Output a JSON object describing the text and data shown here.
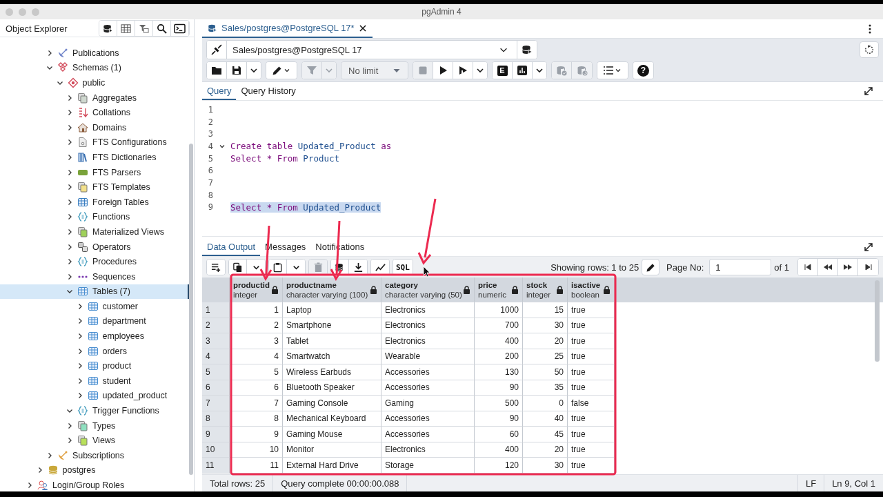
{
  "window": {
    "title": "pgAdmin 4"
  },
  "object_explorer": {
    "title": "Object Explorer",
    "tree": [
      {
        "children": [
          {
            "children": [
              {
                "label": "Publications",
                "kind": "publication",
                "expanded": false,
                "selected": false
              },
              {
                "label": "Schemas (1)",
                "kind": "schema",
                "expanded": true,
                "selected": false,
                "children": [
                  {
                    "label": "public",
                    "kind": "namespace",
                    "expanded": true,
                    "selected": false,
                    "children": [
                      {
                        "label": "Aggregates",
                        "kind": "aggregate",
                        "expanded": false,
                        "selected": false
                      },
                      {
                        "label": "Collations",
                        "kind": "collation",
                        "expanded": false,
                        "selected": false
                      },
                      {
                        "label": "Domains",
                        "kind": "domain",
                        "expanded": false,
                        "selected": false
                      },
                      {
                        "label": "FTS Configurations",
                        "kind": "fts_config",
                        "expanded": false,
                        "selected": false
                      },
                      {
                        "label": "FTS Dictionaries",
                        "kind": "fts_dict",
                        "expanded": false,
                        "selected": false
                      },
                      {
                        "label": "FTS Parsers",
                        "kind": "fts_parser",
                        "expanded": false,
                        "selected": false
                      },
                      {
                        "label": "FTS Templates",
                        "kind": "fts_template",
                        "expanded": false,
                        "selected": false
                      },
                      {
                        "label": "Foreign Tables",
                        "kind": "foreign_table",
                        "expanded": false,
                        "selected": false
                      },
                      {
                        "label": "Functions",
                        "kind": "function",
                        "expanded": false,
                        "selected": false
                      },
                      {
                        "label": "Materialized Views",
                        "kind": "matview",
                        "expanded": false,
                        "selected": false
                      },
                      {
                        "label": "Operators",
                        "kind": "operator",
                        "expanded": false,
                        "selected": false
                      },
                      {
                        "label": "Procedures",
                        "kind": "procedure",
                        "expanded": false,
                        "selected": false
                      },
                      {
                        "label": "Sequences",
                        "kind": "sequence",
                        "expanded": false,
                        "selected": false
                      },
                      {
                        "label": "Tables (7)",
                        "kind": "tables",
                        "expanded": true,
                        "selected": true,
                        "children": [
                          {
                            "label": "customer",
                            "kind": "table",
                            "expanded": false,
                            "selected": false
                          },
                          {
                            "label": "department",
                            "kind": "table",
                            "expanded": false,
                            "selected": false
                          },
                          {
                            "label": "employees",
                            "kind": "table",
                            "expanded": false,
                            "selected": false
                          },
                          {
                            "label": "orders",
                            "kind": "table",
                            "expanded": false,
                            "selected": false
                          },
                          {
                            "label": "product",
                            "kind": "table",
                            "expanded": false,
                            "selected": false
                          },
                          {
                            "label": "student",
                            "kind": "table",
                            "expanded": false,
                            "selected": false
                          },
                          {
                            "label": "updated_product",
                            "kind": "table",
                            "expanded": false,
                            "selected": false
                          }
                        ]
                      },
                      {
                        "label": "Trigger Functions",
                        "kind": "trigger_function",
                        "expanded": true,
                        "selected": false
                      },
                      {
                        "label": "Types",
                        "kind": "type",
                        "expanded": false,
                        "selected": false
                      },
                      {
                        "label": "Views",
                        "kind": "view",
                        "expanded": false,
                        "selected": false
                      }
                    ]
                  }
                ]
              },
              {
                "label": "Subscriptions",
                "kind": "subscription",
                "expanded": false,
                "selected": false
              }
            ]
          },
          {
            "label": "postgres",
            "kind": "database",
            "expanded": false,
            "selected": false
          }
        ]
      },
      {
        "label": "Login/Group Roles",
        "kind": "roles",
        "expanded": false,
        "selected": false
      }
    ]
  },
  "query_tab": {
    "label": "Sales/postgres@PostgreSQL 17*",
    "selected": true
  },
  "connection": {
    "value": "Sales/postgres@PostgreSQL 17"
  },
  "toolbar": [
    {
      "buttons": [
        {
          "kind": "open",
          "disabled": false
        },
        {
          "kind": "save",
          "disabled": false
        },
        {
          "kind": "caret",
          "disabled": false
        }
      ]
    },
    {
      "buttons": [
        {
          "kind": "edit",
          "disabled": false
        }
      ]
    },
    {
      "buttons": [
        {
          "kind": "filter",
          "disabled": true
        },
        {
          "kind": "caret",
          "disabled": true
        }
      ]
    },
    {
      "buttons": [
        {
          "kind": "limit",
          "label": "No limit",
          "disabled": true
        }
      ]
    },
    {
      "buttons": [
        {
          "kind": "stop",
          "disabled": true
        },
        {
          "kind": "run",
          "disabled": false
        },
        {
          "kind": "run_script",
          "disabled": false
        },
        {
          "kind": "caret",
          "disabled": false
        }
      ]
    },
    {
      "buttons": [
        {
          "kind": "explain",
          "label": "E",
          "disabled": false
        },
        {
          "kind": "analyze",
          "disabled": false
        },
        {
          "kind": "caret",
          "disabled": false
        }
      ]
    },
    {
      "buttons": [
        {
          "kind": "commit",
          "disabled": true
        },
        {
          "kind": "rollback",
          "disabled": true
        }
      ]
    },
    {
      "buttons": [
        {
          "kind": "macros",
          "disabled": false
        }
      ]
    },
    {
      "buttons": [
        {
          "kind": "help",
          "label": "?",
          "disabled": false
        }
      ]
    }
  ],
  "editor_tabs": [
    {
      "label": "Query",
      "selected": true
    },
    {
      "label": "Query History",
      "selected": false
    }
  ],
  "code_lines": [
    {
      "number": "1"
    },
    {
      "number": "2"
    },
    {
      "number": "3"
    },
    {
      "number": "4",
      "selected": false,
      "expanded": true,
      "tokens": [
        {
          "text": "Create table ",
          "kind": "keyword"
        },
        {
          "text": "Updated_Product ",
          "kind": "name"
        },
        {
          "text": "as",
          "kind": "keyword"
        }
      ]
    },
    {
      "number": "5",
      "selected": false,
      "tokens": [
        {
          "text": "Select * From ",
          "kind": "keyword"
        },
        {
          "text": "Product",
          "kind": "name"
        }
      ]
    },
    {
      "number": "6"
    },
    {
      "number": "7"
    },
    {
      "number": "8"
    },
    {
      "number": "9",
      "selected": true,
      "tokens": [
        {
          "text": "Select * From ",
          "kind": "keyword"
        },
        {
          "text": "Updated_Product",
          "kind": "name"
        }
      ]
    }
  ],
  "output_tabs": [
    {
      "label": "Data Output",
      "selected": true
    },
    {
      "label": "Messages",
      "selected": false
    },
    {
      "label": "Notifications",
      "selected": false
    }
  ],
  "grid_toolbar": [
    {
      "buttons": [
        {
          "kind": "add_row",
          "disabled": false
        }
      ]
    },
    {
      "buttons": [
        {
          "kind": "copy",
          "disabled": false
        },
        {
          "kind": "caret",
          "disabled": false
        }
      ]
    },
    {
      "buttons": [
        {
          "kind": "paste",
          "disabled": false
        },
        {
          "kind": "caret",
          "disabled": false
        }
      ]
    },
    {
      "buttons": [
        {
          "kind": "delete",
          "disabled": true
        }
      ]
    },
    {
      "buttons": [
        {
          "kind": "save_data",
          "disabled": false
        },
        {
          "kind": "download",
          "disabled": false
        }
      ]
    },
    {
      "buttons": [
        {
          "kind": "graph",
          "disabled": false
        }
      ]
    },
    {
      "buttons": [
        {
          "kind": "sql",
          "label": "SQL",
          "disabled": false
        }
      ]
    }
  ],
  "pagination": {
    "showing": "Showing rows: 1 to 25",
    "page_label": "Page No:",
    "page": "1",
    "of": "of 1"
  },
  "table": {
    "columns": [
      {
        "name": "productid",
        "type": "integer",
        "numeric": true
      },
      {
        "name": "productname",
        "type": "character varying (100)",
        "numeric": false
      },
      {
        "name": "category",
        "type": "character varying (50)",
        "numeric": false
      },
      {
        "name": "price",
        "type": "numeric",
        "numeric": true
      },
      {
        "name": "stock",
        "type": "integer",
        "numeric": true
      },
      {
        "name": "isactive",
        "type": "boolean",
        "numeric": false
      }
    ],
    "rows": [
      {
        "number": "1",
        "cells": [
          "1",
          "Laptop",
          "Electronics",
          "1000",
          "15",
          "true"
        ]
      },
      {
        "number": "2",
        "cells": [
          "2",
          "Smartphone",
          "Electronics",
          "700",
          "30",
          "true"
        ]
      },
      {
        "number": "3",
        "cells": [
          "3",
          "Tablet",
          "Electronics",
          "400",
          "20",
          "true"
        ]
      },
      {
        "number": "4",
        "cells": [
          "4",
          "Smartwatch",
          "Wearable",
          "200",
          "25",
          "true"
        ]
      },
      {
        "number": "5",
        "cells": [
          "5",
          "Wireless Earbuds",
          "Accessories",
          "130",
          "50",
          "true"
        ]
      },
      {
        "number": "6",
        "cells": [
          "6",
          "Bluetooth Speaker",
          "Accessories",
          "90",
          "35",
          "true"
        ]
      },
      {
        "number": "7",
        "cells": [
          "7",
          "Gaming Console",
          "Gaming",
          "500",
          "0",
          "false"
        ]
      },
      {
        "number": "8",
        "cells": [
          "8",
          "Mechanical Keyboard",
          "Accessories",
          "90",
          "40",
          "true"
        ]
      },
      {
        "number": "9",
        "cells": [
          "9",
          "Gaming Mouse",
          "Accessories",
          "60",
          "45",
          "true"
        ]
      },
      {
        "number": "10",
        "cells": [
          "10",
          "Monitor",
          "Electronics",
          "400",
          "20",
          "true"
        ]
      },
      {
        "number": "11",
        "cells": [
          "11",
          "External Hard Drive",
          "Storage",
          "120",
          "30",
          "true"
        ]
      }
    ]
  },
  "status_bar": {
    "total": "Total rows: 25",
    "message": "Query complete 00:00:00.088",
    "eol": "LF",
    "position": "Ln 9, Col 1"
  }
}
